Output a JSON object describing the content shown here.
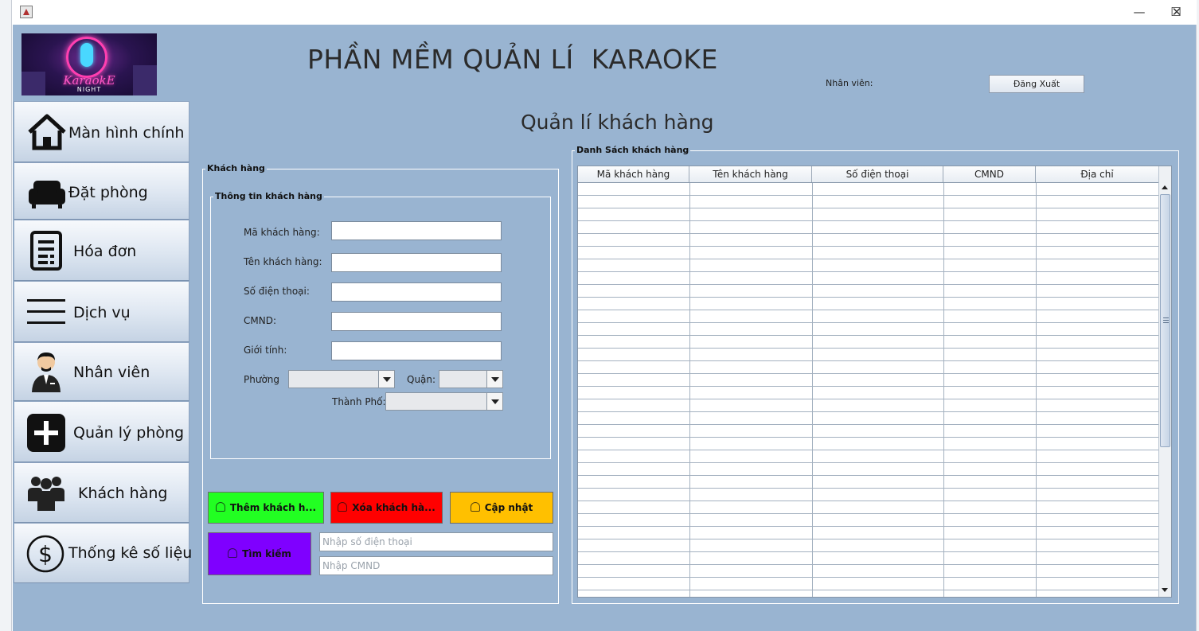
{
  "window": {
    "controls": {
      "minimize": "—",
      "maximize": "☐",
      "close": "✕"
    }
  },
  "header": {
    "logo_text": "KaraokE",
    "logo_sub": "NIGHT",
    "app_title": "PHẦN MỀM QUẢN LÍ  KARAOKE",
    "staff_label": "Nhân viên:",
    "logout_label": "Đăng Xuất"
  },
  "sidebar": {
    "items": [
      {
        "label": "Màn hình chính",
        "icon": "home-icon"
      },
      {
        "label": "Đặt phòng",
        "icon": "sofa-icon"
      },
      {
        "label": "Hóa đơn",
        "icon": "invoice-icon"
      },
      {
        "label": "Dịch vụ",
        "icon": "menu-lines-icon"
      },
      {
        "label": "Nhân viên",
        "icon": "employee-icon"
      },
      {
        "label": "Quản lý phòng",
        "icon": "plus-square-icon"
      },
      {
        "label": "Khách hàng",
        "icon": "people-group-icon"
      },
      {
        "label": "Thống kê số liệu",
        "icon": "dollar-circle-icon"
      }
    ]
  },
  "main": {
    "section_title": "Quản lí khách hàng",
    "customer_group": {
      "title": "Khách hàng",
      "info_group_title": "Thông tin khách hàng",
      "fields": {
        "code": {
          "label": "Mã khách hàng:",
          "value": ""
        },
        "name": {
          "label": "Tên khách hàng:",
          "value": ""
        },
        "phone": {
          "label": "Số điện thoại:",
          "value": ""
        },
        "id_card": {
          "label": "CMND:",
          "value": ""
        },
        "gender": {
          "label": "Giới tính:",
          "value": ""
        }
      },
      "ward_label": "Phường",
      "district_label": "Quận:",
      "city_label": "Thành Phố:",
      "ward_value": "",
      "district_value": "",
      "city_value": ""
    },
    "actions": {
      "add": "Thêm khách h...",
      "delete": "Xóa khách hà...",
      "update": "Cập nhật",
      "search": "Tìm kiếm",
      "phone_search_placeholder": "Nhập số điện thoại",
      "idcard_search_placeholder": "Nhập CMND"
    },
    "action_colors": {
      "add": "#22ff22",
      "delete": "#ff0000",
      "update": "#ffc000",
      "search": "#7f00ff"
    },
    "table": {
      "title": "Danh Sách khách hàng",
      "columns": [
        "Mã khách hàng",
        "Tên khách hàng",
        "Số điện thoại",
        "CMND",
        "Địa chỉ"
      ],
      "rows": []
    }
  }
}
